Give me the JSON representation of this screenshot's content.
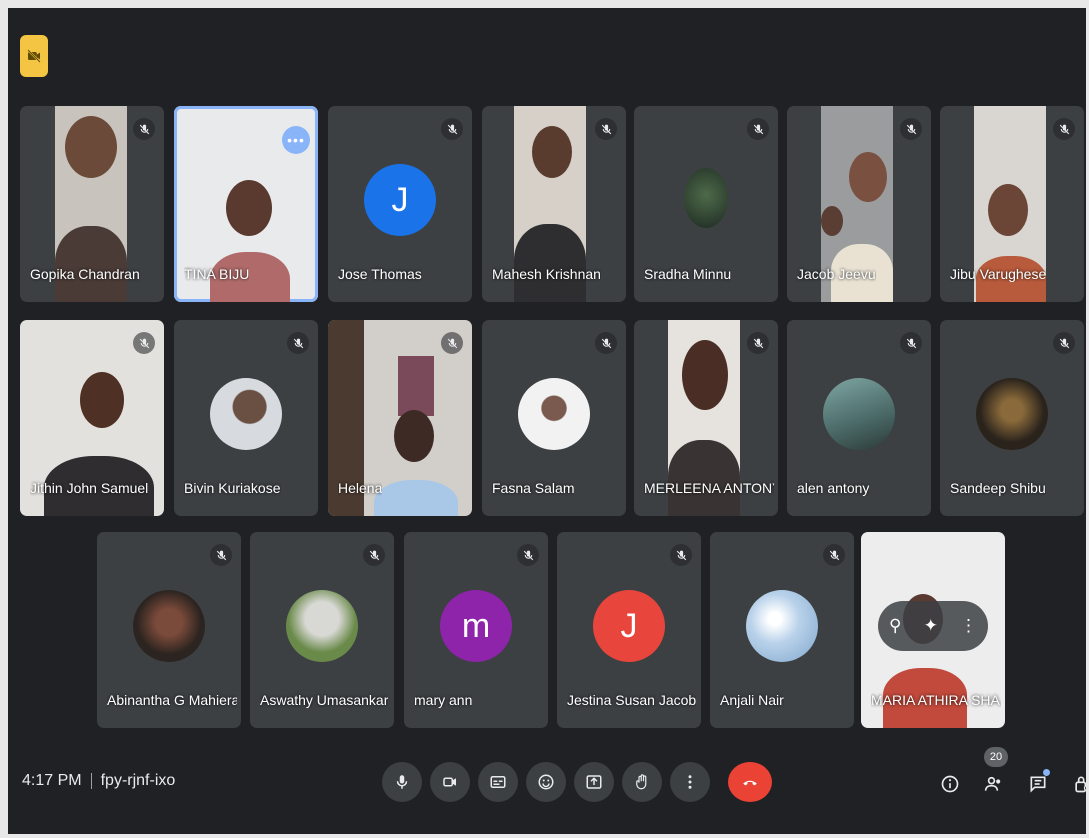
{
  "meeting": {
    "time": "4:17 PM",
    "code": "fpy-rjnf-ixo",
    "participant_count": "20"
  },
  "participants": [
    {
      "name": "Gopika Chandran",
      "kind": "video",
      "muted": true
    },
    {
      "name": "TINA BIJU",
      "kind": "video",
      "muted": false,
      "active": true
    },
    {
      "name": "Jose Thomas",
      "kind": "letter",
      "letter": "J",
      "color": "#1a73e8",
      "muted": true
    },
    {
      "name": "Mahesh Krishnan",
      "kind": "video",
      "muted": true
    },
    {
      "name": "Sradha Minnu",
      "kind": "photo",
      "muted": true
    },
    {
      "name": "Jacob Jeevu",
      "kind": "video",
      "muted": true
    },
    {
      "name": "Jibu Varughese",
      "kind": "video",
      "muted": true
    },
    {
      "name": "Jithin John Samuel",
      "kind": "video",
      "muted": true
    },
    {
      "name": "Bivin Kuriakose",
      "kind": "photo",
      "muted": true
    },
    {
      "name": "Helena",
      "kind": "video",
      "muted": true
    },
    {
      "name": "Fasna Salam",
      "kind": "photo",
      "muted": true
    },
    {
      "name": "MERLEENA ANTONY",
      "kind": "video",
      "muted": true
    },
    {
      "name": "alen antony",
      "kind": "photo",
      "muted": true
    },
    {
      "name": "Sandeep Shibu",
      "kind": "photo",
      "muted": true
    },
    {
      "name": "Abinantha G Mahiera",
      "kind": "photo",
      "muted": true
    },
    {
      "name": "Aswathy Umasankar",
      "kind": "photo",
      "muted": true
    },
    {
      "name": "mary ann",
      "kind": "letter",
      "letter": "m",
      "color": "#8e24aa",
      "muted": true
    },
    {
      "name": "Jestina Susan Jacob",
      "kind": "letter",
      "letter": "J",
      "color": "#e8453c",
      "muted": true
    },
    {
      "name": "Anjali Nair",
      "kind": "photo",
      "muted": true
    },
    {
      "name": "MARIA ATHIRA SHA...",
      "kind": "video",
      "muted": false,
      "self": true
    }
  ],
  "icons": {
    "top_badge": "camera-off-icon",
    "mute": "mic-off-icon",
    "controls": [
      "mic-icon",
      "camera-icon",
      "captions-icon",
      "emoji-icon",
      "present-icon",
      "raise-hand-icon",
      "more-options-icon",
      "end-call-icon"
    ],
    "right": [
      "info-icon",
      "people-icon",
      "chat-icon",
      "activities-icon"
    ]
  },
  "colors": {
    "background": "#202124",
    "tile": "#3c4043",
    "end_call": "#ea4335",
    "highlight": "#8ab4f8",
    "badge": "#f4c542"
  }
}
